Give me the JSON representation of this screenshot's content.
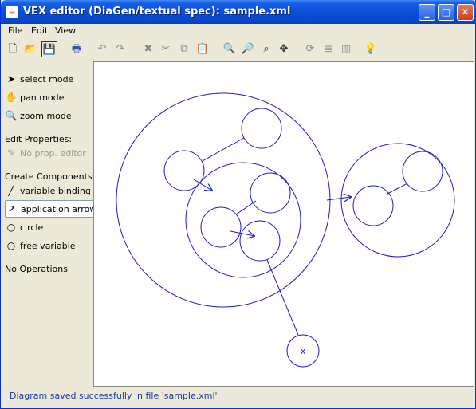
{
  "window": {
    "title": "VEX editor (DiaGen/textual spec): sample.xml",
    "app_icon": "java-icon",
    "controls": [
      "minimize",
      "maximize",
      "close"
    ]
  },
  "menu": {
    "items": [
      "File",
      "Edit",
      "View"
    ]
  },
  "toolbar": {
    "icons": [
      "new-icon",
      "open-icon",
      "save-icon",
      "print-icon",
      "undo-icon",
      "redo-icon",
      "delete-icon",
      "cut-icon",
      "copy-icon",
      "paste-icon",
      "zoom-in-icon",
      "zoom-out-icon",
      "zoom-fit-icon",
      "move-icon",
      "refresh-icon",
      "export-icon",
      "import-icon",
      "hint-icon"
    ]
  },
  "sidebar": {
    "modes": [
      "select mode",
      "pan mode",
      "zoom mode"
    ],
    "edit_properties_heading": "Edit Properties:",
    "prop_editor": "No prop. editor",
    "create_heading": "Create Components:",
    "components": [
      "variable binding",
      "application arrow",
      "circle",
      "free variable"
    ],
    "selected_component": "application arrow",
    "operations": "No Operations"
  },
  "diagram": {
    "free_variable_label": "x",
    "stroke_color": "#1a1acc"
  },
  "status": {
    "message": "Diagram saved successfully in file 'sample.xml'"
  }
}
